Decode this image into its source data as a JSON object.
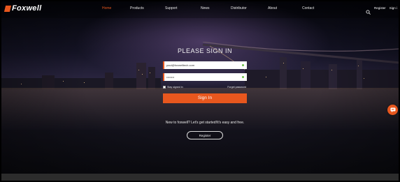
{
  "brand": {
    "name": "Foxwell",
    "logo_color": "#e8571e"
  },
  "nav": {
    "items": [
      {
        "label": "Home",
        "active": true
      },
      {
        "label": "Products",
        "active": false
      },
      {
        "label": "Support",
        "active": false
      },
      {
        "label": "News",
        "active": false
      },
      {
        "label": "Distributor",
        "active": false
      },
      {
        "label": "About",
        "active": false
      },
      {
        "label": "Contact",
        "active": false
      }
    ],
    "search_icon": "search-icon",
    "register_label": "Register",
    "signin_label": "Sign i"
  },
  "form": {
    "title": "PLEASE SIGN IN",
    "email_value": "paul@foxwelltech.com",
    "password_value": "••••••••",
    "remember_label": "Stay signed in",
    "forgot_label": "Forget password",
    "signin_button": "Sign In",
    "promo_text": "New to foxwell? Let's get started!It's easy and free.",
    "register_button": "Register"
  },
  "colors": {
    "accent": "#e8571e",
    "valid": "#6cc04a"
  },
  "chat_icon": "chat-icon"
}
